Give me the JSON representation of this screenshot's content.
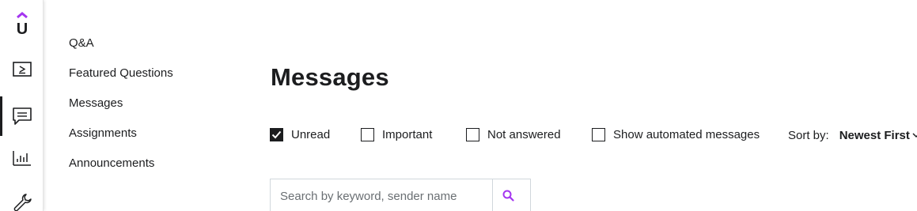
{
  "rail": {
    "logo": "U",
    "items": [
      {
        "icon": "video-icon"
      },
      {
        "icon": "message-icon",
        "active": true
      },
      {
        "icon": "chart-icon"
      },
      {
        "icon": "wrench-icon"
      }
    ]
  },
  "sub_nav": {
    "items": [
      {
        "label": "Q&A"
      },
      {
        "label": "Featured Questions"
      },
      {
        "label": "Messages"
      },
      {
        "label": "Assignments"
      },
      {
        "label": "Announcements"
      }
    ]
  },
  "main": {
    "title": "Messages",
    "filters": [
      {
        "label": "Unread",
        "checked": true
      },
      {
        "label": "Important",
        "checked": false
      },
      {
        "label": "Not answered",
        "checked": false
      },
      {
        "label": "Show automated messages",
        "checked": false
      }
    ],
    "sort": {
      "label": "Sort by:",
      "value": "Newest First"
    },
    "search": {
      "placeholder": "Search by keyword, sender name"
    }
  },
  "colors": {
    "brand": "#a435f0",
    "text": "#1c1d1f",
    "border": "#d1d7dc"
  }
}
